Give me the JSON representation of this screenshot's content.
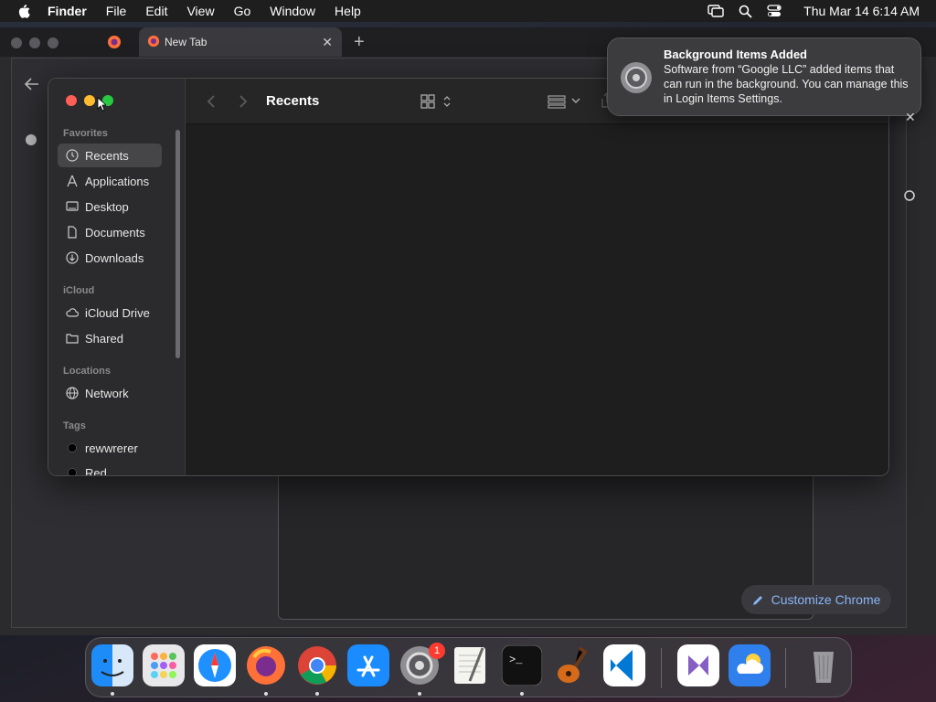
{
  "menubar": {
    "app_name": "Finder",
    "menus": [
      "File",
      "Edit",
      "View",
      "Go",
      "Window",
      "Help"
    ],
    "clock": "Thu Mar 14  6:14 AM"
  },
  "chrome": {
    "tab_title": "New Tab",
    "customize_label": "Customize Chrome"
  },
  "finder": {
    "title": "Recents",
    "sidebar": {
      "favorites_header": "Favorites",
      "favorites": [
        {
          "label": "Recents",
          "icon": "clock-icon",
          "selected": true
        },
        {
          "label": "Applications",
          "icon": "applications-icon"
        },
        {
          "label": "Desktop",
          "icon": "desktop-icon"
        },
        {
          "label": "Documents",
          "icon": "document-icon"
        },
        {
          "label": "Downloads",
          "icon": "download-icon"
        }
      ],
      "icloud_header": "iCloud",
      "icloud": [
        {
          "label": "iCloud Drive",
          "icon": "cloud-icon"
        },
        {
          "label": "Shared",
          "icon": "shared-folder-icon"
        }
      ],
      "locations_header": "Locations",
      "locations": [
        {
          "label": "Network",
          "icon": "globe-icon"
        }
      ],
      "tags_header": "Tags",
      "tags": [
        {
          "label": "rewwrerer",
          "color": "#000000"
        },
        {
          "label": "Red",
          "color": "#000000"
        }
      ]
    }
  },
  "notification": {
    "title": "Background Items Added",
    "body": "Software from “Google LLC” added items that can run in the background. You can manage this in Login Items Settings."
  },
  "dock": {
    "badge": "1",
    "apps": [
      "finder-icon",
      "launchpad-icon",
      "safari-icon",
      "firefox-icon",
      "chrome-icon",
      "app-store-icon",
      "system-settings-icon",
      "textedit-icon",
      "terminal-icon",
      "garageband-icon",
      "vscode-icon",
      "visual-studio-icon",
      "weather-icon",
      "trash-icon"
    ]
  }
}
